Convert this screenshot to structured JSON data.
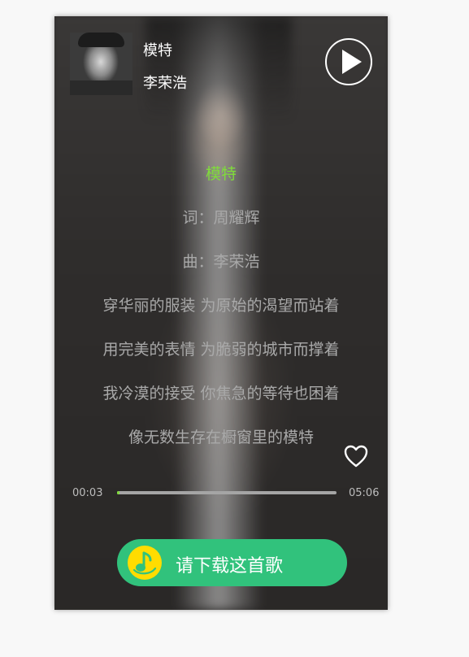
{
  "header": {
    "title": "模特",
    "artist": "李荣浩"
  },
  "lyrics": [
    {
      "text": "模特",
      "active": true
    },
    {
      "text": "词：周耀辉",
      "active": false
    },
    {
      "text": "曲：李荣浩",
      "active": false
    },
    {
      "text": "穿华丽的服装 为原始的渴望而站着",
      "active": false
    },
    {
      "text": "用完美的表情 为脆弱的城市而撑着",
      "active": false
    },
    {
      "text": "我冷漠的接受 你焦急的等待也困着",
      "active": false
    },
    {
      "text": "像无数生存在橱窗里的模特",
      "active": false
    }
  ],
  "player": {
    "current_time": "00:03",
    "total_time": "05:06",
    "progress": 0.01
  },
  "download": {
    "label": "请下载这首歌"
  },
  "colors": {
    "accent_green": "#7fdc3a",
    "button_green": "#31c27c",
    "qq_yellow": "#ffdc00"
  },
  "icons": [
    "play-icon",
    "heart-icon",
    "qq-music-logo-icon"
  ]
}
